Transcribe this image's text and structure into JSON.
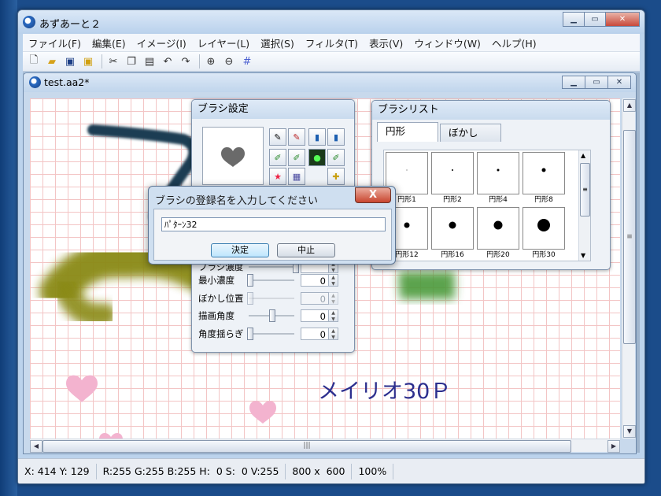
{
  "app": {
    "title": "あずあーと２"
  },
  "menu": [
    "ファイル(F)",
    "編集(E)",
    "イメージ(I)",
    "レイヤー(L)",
    "選択(S)",
    "フィルタ(T)",
    "表示(V)",
    "ウィンドウ(W)",
    "ヘルプ(H)"
  ],
  "document": {
    "title": "test.aa2*",
    "canvas_text": "メイリオ30Ｐ"
  },
  "brush_settings": {
    "title": "ブラシ設定",
    "sliders": [
      {
        "label": "ブラシ濃度",
        "value": ""
      },
      {
        "label": "最小濃度",
        "value": "0"
      },
      {
        "label": "ぼかし位置",
        "value": "0"
      },
      {
        "label": "描画角度",
        "value": "0"
      },
      {
        "label": "角度揺らぎ",
        "value": "0"
      }
    ]
  },
  "brush_list": {
    "title": "ブラシリスト",
    "tabs": [
      "円形",
      "ぼかし"
    ],
    "brushes": [
      {
        "name": "円形1",
        "size": 1
      },
      {
        "name": "円形2",
        "size": 2
      },
      {
        "name": "円形4",
        "size": 3
      },
      {
        "name": "円形8",
        "size": 5
      },
      {
        "name": "円形12",
        "size": 7
      },
      {
        "name": "円形16",
        "size": 9
      },
      {
        "name": "円形20",
        "size": 11
      },
      {
        "name": "円形30",
        "size": 16
      }
    ]
  },
  "dialog": {
    "title": "ブラシの登録名を入力してください",
    "input_value": "ﾊﾟﾀｰﾝ32",
    "ok_label": "決定",
    "cancel_label": "中止",
    "close_label": "X"
  },
  "status": {
    "coords": "X: 414 Y: 129",
    "color": "R:255 G:255 B:255 H:  0 S:  0 V:255",
    "size": "800 x  600",
    "zoom": "100%"
  }
}
